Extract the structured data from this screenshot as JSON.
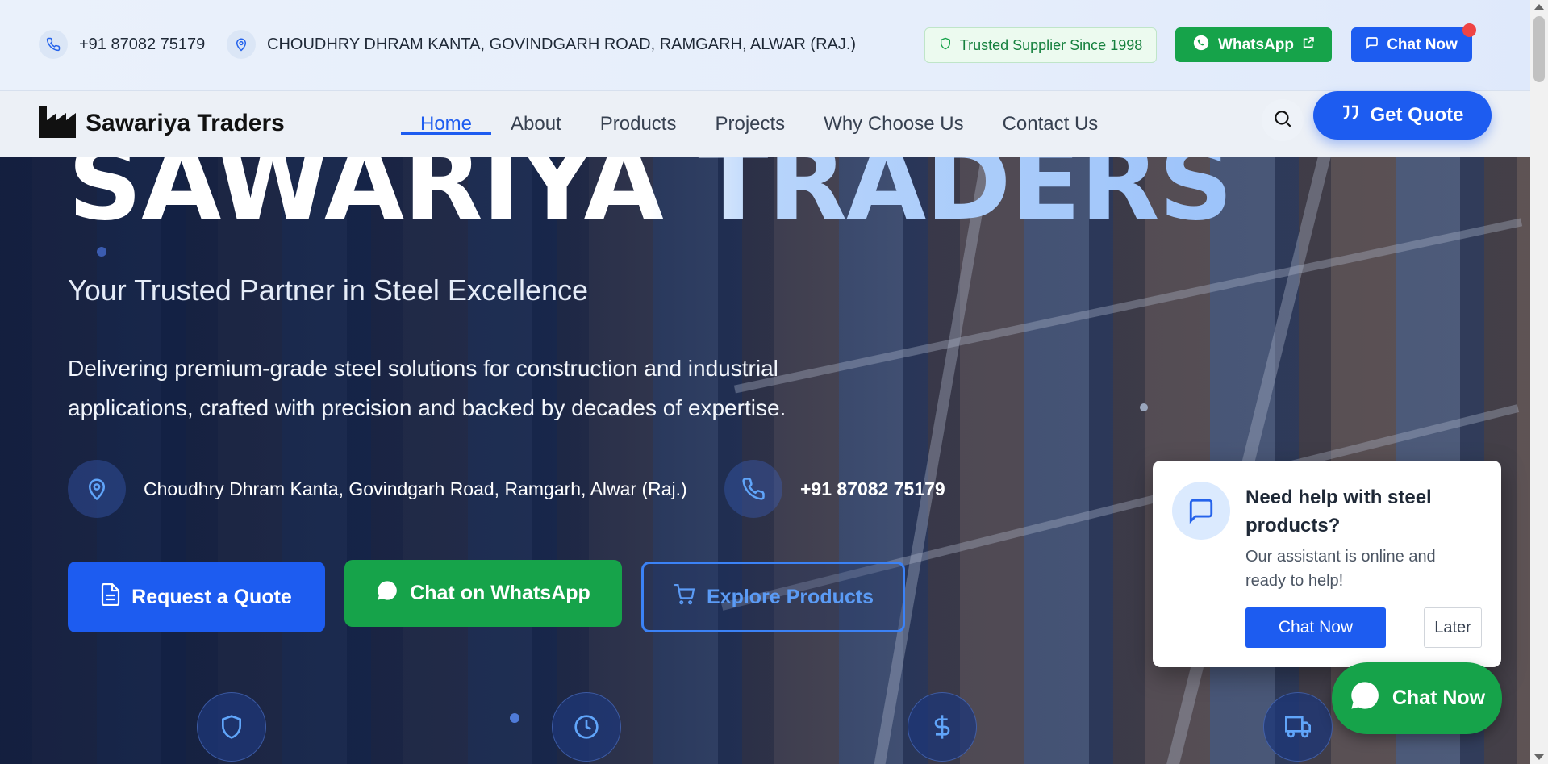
{
  "topbar": {
    "phone": "+91 87082 75179",
    "address": "CHOUDHRY DHRAM KANTA, GOVINDGARH ROAD, RAMGARH, ALWAR (RAJ.)",
    "trusted_badge": "Trusted Supplier Since 1998",
    "whatsapp_label": "WhatsApp",
    "chat_label": "Chat Now"
  },
  "nav": {
    "brand": "Sawariya Traders",
    "links": [
      {
        "label": "Home",
        "active": true
      },
      {
        "label": "About"
      },
      {
        "label": "Products"
      },
      {
        "label": "Projects"
      },
      {
        "label": "Why Choose Us"
      },
      {
        "label": "Contact Us"
      }
    ],
    "quote_label": "Get Quote"
  },
  "hero": {
    "title": "SAWARIYA TRADERS",
    "subtitle": "Your Trusted Partner in Steel Excellence",
    "description": "Delivering premium-grade steel solutions for construction and industrial applications, crafted with precision and backed by decades of expertise.",
    "address": "Choudhry Dhram Kanta, Govindgarh Road, Ramgarh, Alwar (Raj.)",
    "phone": "+91 87082 75179",
    "btn_quote": "Request a Quote",
    "btn_whatsapp": "Chat on WhatsApp",
    "btn_explore": "Explore Products",
    "feature_icons": [
      "shield-icon",
      "clock-icon",
      "dollar-icon",
      "truck-icon"
    ]
  },
  "chat_popup": {
    "title": "Need help with steel products?",
    "text": "Our assistant is online and ready to help!",
    "chat_label": "Chat Now",
    "later_label": "Later"
  },
  "floating_chat": {
    "label": "Chat Now"
  },
  "colors": {
    "primary": "#1d5cf0",
    "whatsapp": "#16a34a",
    "alert": "#ef4444"
  }
}
